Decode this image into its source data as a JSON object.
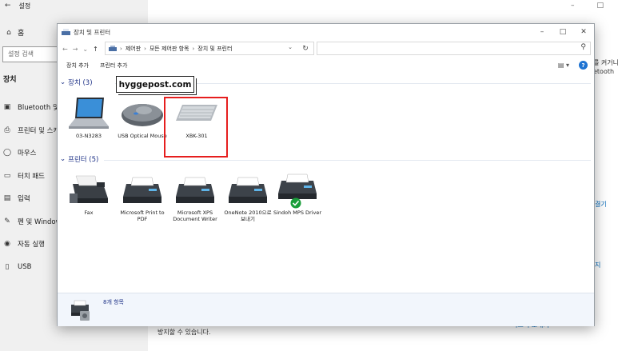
{
  "settings": {
    "title": "설정",
    "back_glyph": "←",
    "home_label": "홈",
    "search_placeholder": "설정 검색",
    "section": "장치",
    "nav": [
      {
        "label": "Bluetooth 및",
        "icon": "bluetooth-icon"
      },
      {
        "label": "프린터 및 스캐",
        "icon": "printer-icon"
      },
      {
        "label": "마우스",
        "icon": "mouse-icon"
      },
      {
        "label": "터치 패드",
        "icon": "touchpad-icon"
      },
      {
        "label": "입력",
        "icon": "keyboard-icon"
      },
      {
        "label": "펜 및 Window",
        "icon": "pen-icon"
      },
      {
        "label": "자동 실행",
        "icon": "autoplay-icon"
      },
      {
        "label": "USB",
        "icon": "usb-icon"
      }
    ],
    "right_edge": {
      "line1": "를 켜거니",
      "line2": "etooth",
      "link1": "결기",
      "link2": "지"
    },
    "bottom_text": "방지할 수 있습니다.",
    "bottom_link": "피드백 보내기"
  },
  "cp": {
    "title": "장치 및 프린터",
    "breadcrumb": [
      "제어판",
      "모든 제어판 항목",
      "장치 및 프린터"
    ],
    "toolbar": {
      "add_device": "장치 추가",
      "add_printer": "프린터 추가"
    },
    "groups": {
      "devices": "장치 (3)",
      "printers": "프린터 (5)"
    },
    "devices": [
      {
        "label": "03-N3283",
        "icon": "laptop-icon"
      },
      {
        "label": "USB Optical Mouse",
        "icon": "mouse-device-icon"
      },
      {
        "label": "XBK-301",
        "icon": "keyboard-device-icon"
      }
    ],
    "printers": [
      {
        "label": "Fax",
        "icon": "fax-icon"
      },
      {
        "label": "Microsoft Print to PDF",
        "icon": "printer-device-icon"
      },
      {
        "label": "Microsoft XPS Document Writer",
        "icon": "printer-device-icon"
      },
      {
        "label": "OneNote 2010으로 보내기",
        "icon": "printer-device-icon"
      },
      {
        "label": "Sindoh MPS Driver",
        "icon": "default-printer-icon"
      }
    ],
    "status": "8개 항목",
    "watermark": "hyggepost.com"
  },
  "colors": {
    "highlight": "#e61e1e",
    "group_text": "#1e3287",
    "default_check": "#1a9e3a"
  }
}
